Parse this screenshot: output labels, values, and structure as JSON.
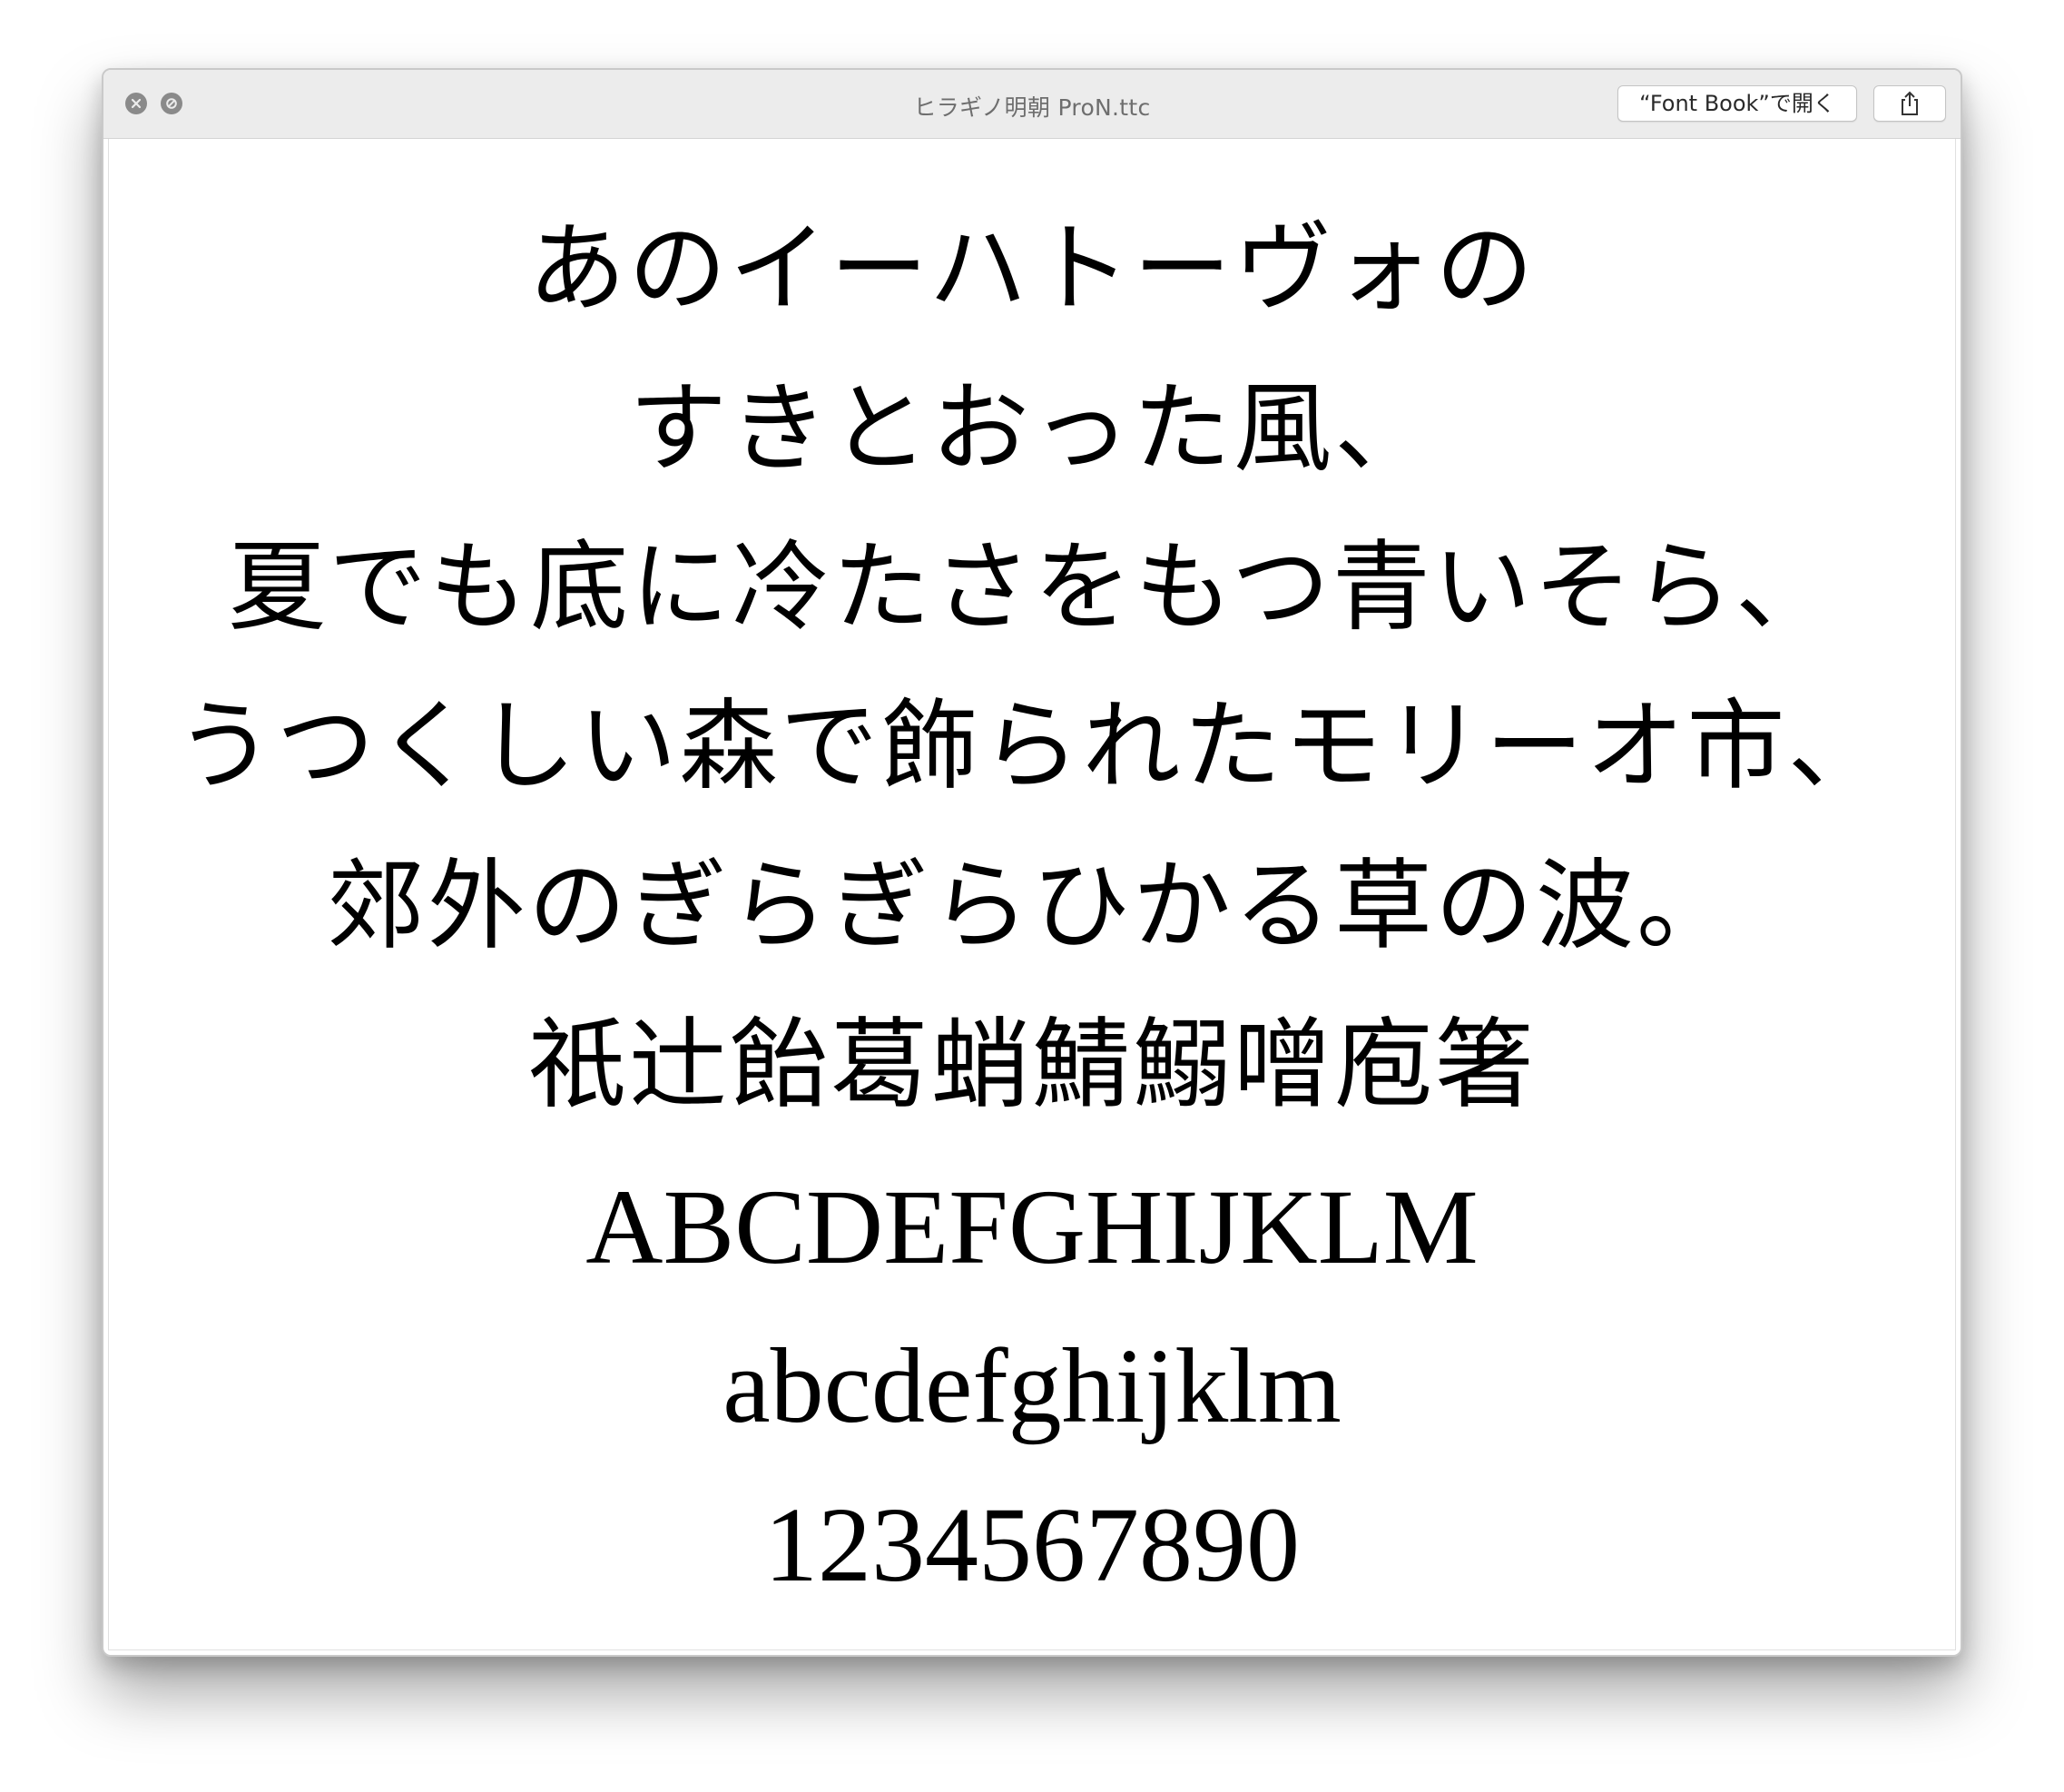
{
  "window": {
    "title": "ヒラギノ明朝 ProN.ttc",
    "open_button_label": "“Font Book”で開く",
    "share_icon": "share-icon",
    "close_icon": "close-icon",
    "minimize_icon": "minimize-icon"
  },
  "sample": {
    "lines": [
      "あのイーハトーヴォの",
      "すきとおった風、",
      "夏でも底に冷たさをもつ青いそら、",
      "うつくしい森で飾られたモリーオ市、",
      "郊外のぎらぎらひかる草の波。",
      "祇辻飴葛蛸鯖鰯噌庖箸",
      "ABCDEFGHIJKLM",
      "abcdefghijklm",
      "1234567890"
    ]
  }
}
